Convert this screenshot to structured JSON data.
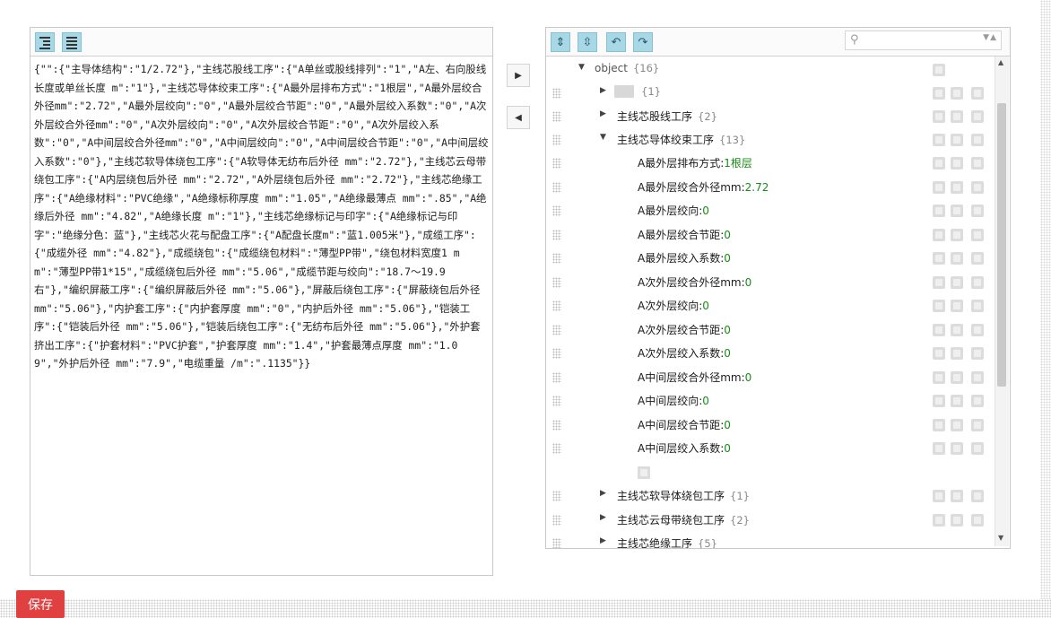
{
  "left_editor": {
    "format_button_icon": "format-icon",
    "compact_button_icon": "compact-icon",
    "json_text": "{\"\":{\"主导体结构\":\"1/2.72\"},\"主线芯股线工序\":{\"A单丝或股线排列\":\"1\",\"A左、右向股线长度或单丝长度 m\":\"1\"},\"主线芯导体绞束工序\":{\"A最外层排布方式\":\"1根层\",\"A最外层绞合外径mm\":\"2.72\",\"A最外层绞向\":\"0\",\"A最外层绞合节距\":\"0\",\"A最外层绞入系数\":\"0\",\"A次外层绞合外径mm\":\"0\",\"A次外层绞向\":\"0\",\"A次外层绞合节距\":\"0\",\"A次外层绞入系数\":\"0\",\"A中间层绞合外径mm\":\"0\",\"A中间层绞向\":\"0\",\"A中间层绞合节距\":\"0\",\"A中间层绞入系数\":\"0\"},\"主线芯软导体绕包工序\":{\"A软导体无纺布后外径 mm\":\"2.72\"},\"主线芯云母带绕包工序\":{\"A内层绕包后外径 mm\":\"2.72\",\"A外层绕包后外径 mm\":\"2.72\"},\"主线芯绝缘工序\":{\"A绝缘材料\":\"PVC绝缘\",\"A绝缘标称厚度 mm\":\"1.05\",\"A绝缘最薄点 mm\":\".85\",\"A绝缘后外径 mm\":\"4.82\",\"A绝缘长度 m\":\"1\"},\"主线芯绝缘标记与印字\":{\"A绝缘标记与印字\":\"绝缘分色：蓝\"},\"主线芯火花与配盘工序\":{\"A配盘长度m\":\"蓝1.005米\"},\"成缆工序\":{\"成缆外径 mm\":\"4.82\"},\"成缆绕包\":{\"成缆绕包材料\":\"薄型PP带\",\"绕包材料宽度1 mm\":\"薄型PP带1*15\",\"成缆绕包后外径 mm\":\"5.06\",\"成缆节距与绞向\":\"18.7～19.9右\"},\"编织屏蔽工序\":{\"编织屏蔽后外径 mm\":\"5.06\"},\"屏蔽后绕包工序\":{\"屏蔽绕包后外径 mm\":\"5.06\"},\"内护套工序\":{\"内护套厚度 mm\":\"0\",\"内护后外径 mm\":\"5.06\"},\"铠装工序\":{\"铠装后外径 mm\":\"5.06\"},\"铠装后绕包工序\":{\"无纺布后外径 mm\":\"5.06\"},\"外护套挤出工序\":{\"护套材料\":\"PVC护套\",\"护套厚度 mm\":\"1.4\",\"护套最薄点厚度 mm\":\"1.09\",\"外护后外径 mm\":\"7.9\",\"电缆重量 /m\":\".1135\"}}"
  },
  "middle": {
    "copy_right_icon": "triangle-right-icon",
    "copy_left_icon": "triangle-left-icon",
    "copy_right_glyph": "▶",
    "copy_left_glyph": "◀"
  },
  "right_tree": {
    "toolbar_icons": [
      "expand-all-icon",
      "collapse-all-icon",
      "undo-icon",
      "redo-icon"
    ],
    "toolbar_glyphs": [
      "⇕",
      "⇳",
      "↶",
      "↷"
    ],
    "search_placeholder": "",
    "root": {
      "label": "object",
      "count": "{16}"
    },
    "nodes": [
      {
        "key": "",
        "count": "{1}",
        "type": "collapsed"
      },
      {
        "key": "主线芯股线工序",
        "count": "{2}",
        "type": "collapsed"
      },
      {
        "key": "主线芯导体绞束工序",
        "count": "{13}",
        "type": "expanded"
      },
      {
        "key": "A最外层排布方式",
        "value": "1根层"
      },
      {
        "key": "A最外层绞合外径mm",
        "value": "2.72"
      },
      {
        "key": "A最外层绞向",
        "value": "0"
      },
      {
        "key": "A最外层绞合节距",
        "value": "0"
      },
      {
        "key": "A最外层绞入系数",
        "value": "0"
      },
      {
        "key": "A次外层绞合外径mm",
        "value": "0"
      },
      {
        "key": "A次外层绞向",
        "value": "0"
      },
      {
        "key": "A次外层绞合节距",
        "value": "0"
      },
      {
        "key": "A次外层绞入系数",
        "value": "0"
      },
      {
        "key": "A中间层绞合外径mm",
        "value": "0"
      },
      {
        "key": "A中间层绞向",
        "value": "0"
      },
      {
        "key": "A中间层绞合节距",
        "value": "0"
      },
      {
        "key": "A中间层绞入系数",
        "value": "0"
      },
      {
        "key": "主线芯软导体绕包工序",
        "count": "{1}",
        "type": "collapsed"
      },
      {
        "key": "主线芯云母带绕包工序",
        "count": "{2}",
        "type": "collapsed"
      },
      {
        "key": "主线芯绝缘工序",
        "count": "{5}",
        "type": "collapsed"
      }
    ],
    "separator": ":"
  },
  "footer": {
    "save_label": "保存"
  },
  "colors": {
    "accent_button": "#a8d8e6",
    "save_button": "#e0403f",
    "value_green": "#1a8a1a"
  }
}
